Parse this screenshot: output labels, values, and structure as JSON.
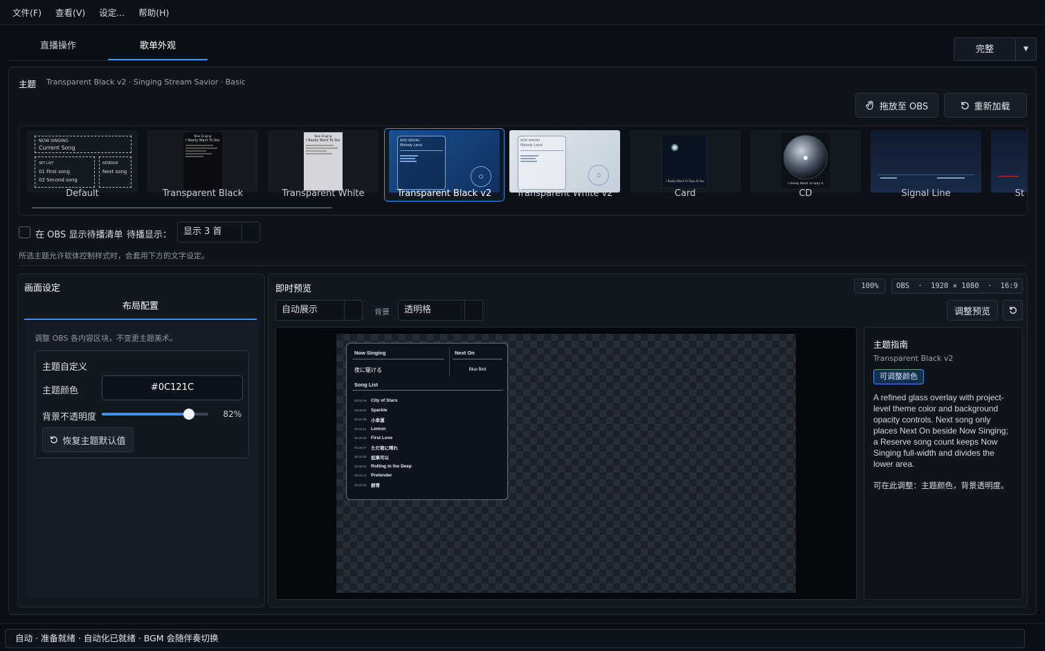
{
  "menu": [
    "文件(F)",
    "查看(V)",
    "设定...",
    "帮助(H)"
  ],
  "tabs": [
    "直播操作",
    "歌单外观"
  ],
  "mode": {
    "label": "完整"
  },
  "theme": {
    "label": "主题",
    "subtitle": "Transparent Black v2 · Singing Stream Savior · Basic",
    "drag_obs": "拖放至 OBS",
    "reload": "重新加载"
  },
  "themes": [
    "Default",
    "Transparent Black",
    "Transparent White",
    "Transparent Black v2",
    "Transparent White v2",
    "Card",
    "CD",
    "Signal Line",
    "St"
  ],
  "thumb_text": {
    "now_singing": "NOW SINGING",
    "current_song": "Current Song",
    "set_list": "SET LIST",
    "first": "01 First song",
    "second": "02 Second song",
    "reserve": "RESERVE",
    "next": "Next song",
    "melody": "Melody Land",
    "ns_title": "Now Singing",
    "really": "I Really Want To Sta",
    "cd_song": "I Really Want To Stay A",
    "card_song": "I Really Want To Stay At You"
  },
  "obs": {
    "show_queue": "在 OBS 显示待播清单",
    "queue_display": "待播显示：",
    "queue_count": "显示 3 首",
    "note": "所选主题允许软体控制样式时，会套用下方的文字设定。"
  },
  "screen": {
    "title": "画面设定",
    "layout_tab": "布局配置",
    "hint": "调整 OBS 各内容区块，不变更主题美术。",
    "custom_title": "主题自定义",
    "color_label": "主题颜色",
    "color_value": "#0C121C",
    "opacity_label": "背景不透明度",
    "opacity": "82%",
    "opacity_fraction": 0.82,
    "reset": "恢复主题默认值"
  },
  "preview": {
    "title": "即时预览",
    "zoom": "100%",
    "obs": "OBS",
    "res": "1920 × 1080",
    "ratio": "16:9",
    "mode": "自动展示",
    "bg_label": "背景",
    "bg_value": "透明格",
    "adjust": "调整预览"
  },
  "overlay": {
    "now_singing": "Now Singing",
    "next_on": "Next On",
    "current": "夜に駆ける",
    "next_song": "Blue Bird",
    "song_list": "Song List",
    "songs": [
      {
        "t": "00:04:18",
        "n": "City of Stars"
      },
      {
        "t": "00:09:53",
        "n": "Sparkle"
      },
      {
        "t": "00:15:36",
        "n": "小幸運"
      },
      {
        "t": "00:20:11",
        "n": "Lemon"
      },
      {
        "t": "00:25:03",
        "n": "First Love"
      },
      {
        "t": "00:29:27",
        "n": "ただ君に晴れ"
      },
      {
        "t": "00:34:09",
        "n": "如果可以"
      },
      {
        "t": "00:38:54",
        "n": "Rolling in the Deep"
      },
      {
        "t": "00:43:41",
        "n": "Pretender"
      },
      {
        "t": "00:48:26",
        "n": "群青"
      }
    ]
  },
  "guide": {
    "title": "主题指南",
    "theme": "Transparent Black v2",
    "badge": "可调整颜色",
    "desc": "A refined glass overlay with project-level theme color and background opacity controls. Next song only places Next On beside Now Singing; a Reserve song count keeps Now Singing full-width and divides the lower area.",
    "note": "可在此调整：主题颜色，背景透明度。"
  },
  "status": "自动 · 准备就绪 · 自动化已就绪 · BGM 会随伴奏切换",
  "colors": {
    "accent": "#3d8ff0",
    "bg": "#0b0f15",
    "theme_color": "#0C121C"
  }
}
